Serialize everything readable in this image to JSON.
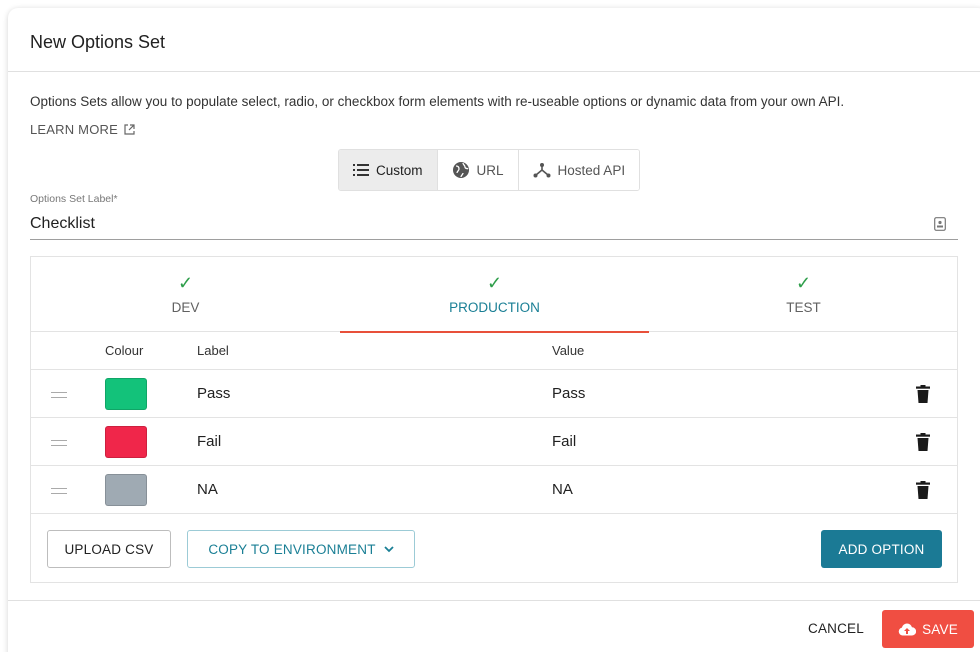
{
  "dialog": {
    "title": "New Options Set",
    "description": "Options Sets allow you to populate select, radio, or checkbox form elements with re-useable options or dynamic data from your own API.",
    "learn_more": "LEARN MORE"
  },
  "source_toggle": {
    "options": [
      {
        "label": "Custom",
        "icon": "list-icon",
        "selected": true
      },
      {
        "label": "URL",
        "icon": "globe-icon",
        "selected": false
      },
      {
        "label": "Hosted API",
        "icon": "api-icon",
        "selected": false
      }
    ]
  },
  "label_field": {
    "label": "Options Set Label*",
    "value": "Checklist",
    "icon": "contact-card-icon"
  },
  "environments": {
    "tabs": [
      {
        "label": "DEV",
        "valid": true,
        "active": false
      },
      {
        "label": "PRODUCTION",
        "valid": true,
        "active": true
      },
      {
        "label": "TEST",
        "valid": true,
        "active": false
      }
    ],
    "check_mark": "✓"
  },
  "options_table": {
    "headers": {
      "colour": "Colour",
      "label": "Label",
      "value": "Value"
    },
    "rows": [
      {
        "colour": "#13c27a",
        "label": "Pass",
        "value": "Pass"
      },
      {
        "colour": "#f0264a",
        "label": "Fail",
        "value": "Fail"
      },
      {
        "colour": "#9faab3",
        "label": "NA",
        "value": "NA"
      }
    ]
  },
  "panel_actions": {
    "upload_csv": "UPLOAD CSV",
    "copy_to_environment": "COPY TO ENVIRONMENT",
    "add_option": "ADD OPTION"
  },
  "footer": {
    "cancel": "CANCEL",
    "save": "SAVE"
  },
  "colors": {
    "accent_teal": "#1b7a95",
    "save_red": "#f04e42",
    "active_tab_underline": "#e8503a",
    "check_green": "#2e9e4a"
  }
}
